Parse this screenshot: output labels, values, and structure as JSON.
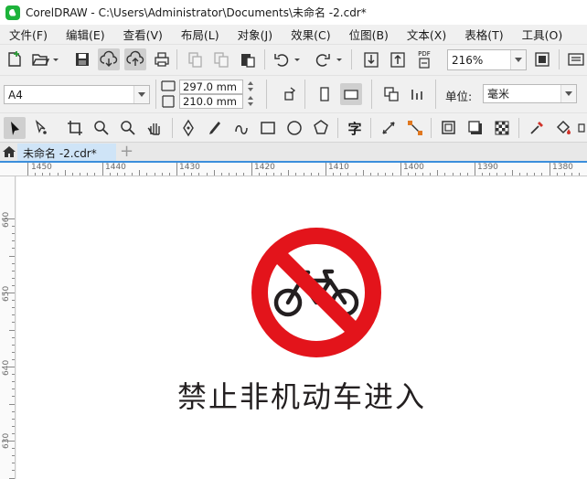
{
  "window": {
    "title": "CorelDRAW - C:\\Users\\Administrator\\Documents\\未命名 -2.cdr*"
  },
  "menu": [
    "文件(F)",
    "编辑(E)",
    "查看(V)",
    "布局(L)",
    "对象(J)",
    "效果(C)",
    "位图(B)",
    "文本(X)",
    "表格(T)",
    "工具(O)"
  ],
  "toolbar": {
    "zoom": "216%",
    "pdf_label": "PDF"
  },
  "property_bar": {
    "page_size": "A4",
    "width": "297.0 mm",
    "height": "210.0 mm",
    "unit_label": "单位:",
    "unit_value": "毫米"
  },
  "toolbox": {
    "text_tool_glyph": "字"
  },
  "tabs": {
    "document": "未命名 -2.cdr*",
    "add": "+"
  },
  "ruler": {
    "horizontal": [
      "1450",
      "1440",
      "1430",
      "1420",
      "1410",
      "1400",
      "1390",
      "1380"
    ],
    "vertical": [
      "660",
      "650",
      "640",
      "630"
    ]
  },
  "canvas": {
    "sign_text": "禁止非机动车进入"
  },
  "colors": {
    "sign_red": "#e3141b",
    "sign_black": "#231f20",
    "tab_active": "#cfe4f7",
    "ruler_accent": "#3b8edb"
  }
}
